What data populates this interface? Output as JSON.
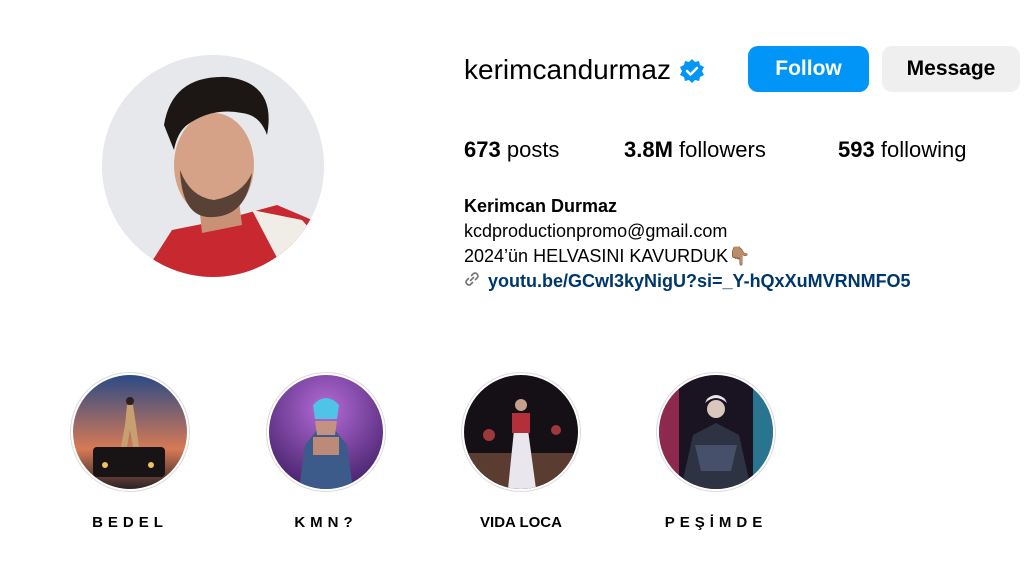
{
  "profile": {
    "username": "kerimcandurmaz",
    "verified_icon": "verified-badge-icon",
    "follow_label": "Follow",
    "message_label": "Message",
    "stats": {
      "posts_count": "673",
      "posts_label": "posts",
      "followers_count": "3.8M",
      "followers_label": "followers",
      "following_count": "593",
      "following_label": "following"
    },
    "bio": {
      "full_name": "Kerimcan Durmaz",
      "line1": "kcdproductionpromo@gmail.com",
      "line2": "2024’ün HELVASINI KAVURDUK",
      "line2_emoji": "👇🏽",
      "link_icon": "link-icon",
      "link": "youtu.be/GCwI3kyNigU?si=_Y-hQxXuMVRNMFO5"
    }
  },
  "highlights": [
    {
      "label": "BEDEL"
    },
    {
      "label": "KMN?"
    },
    {
      "label": "VIDA LOCA"
    },
    {
      "label": "PEŞİMDE"
    }
  ],
  "colors": {
    "accent": "#0095f6",
    "link": "#00376b",
    "secondary_button": "#efefef"
  }
}
